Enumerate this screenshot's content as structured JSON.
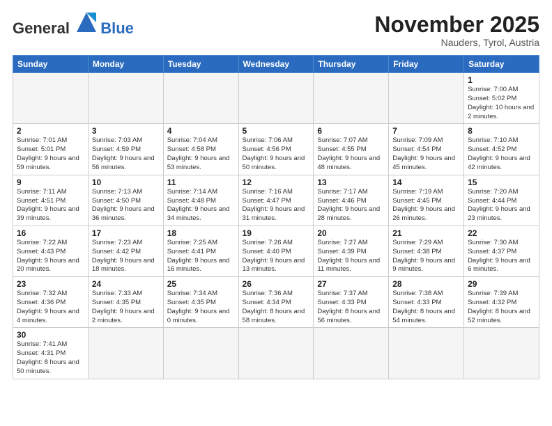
{
  "logo": {
    "text_general": "General",
    "text_blue": "Blue"
  },
  "header": {
    "month": "November 2025",
    "location": "Nauders, Tyrol, Austria"
  },
  "weekdays": [
    "Sunday",
    "Monday",
    "Tuesday",
    "Wednesday",
    "Thursday",
    "Friday",
    "Saturday"
  ],
  "days": {
    "1": {
      "sunrise": "7:00 AM",
      "sunset": "5:02 PM",
      "daylight": "10 hours and 2 minutes."
    },
    "2": {
      "sunrise": "7:01 AM",
      "sunset": "5:01 PM",
      "daylight": "9 hours and 59 minutes."
    },
    "3": {
      "sunrise": "7:03 AM",
      "sunset": "4:59 PM",
      "daylight": "9 hours and 56 minutes."
    },
    "4": {
      "sunrise": "7:04 AM",
      "sunset": "4:58 PM",
      "daylight": "9 hours and 53 minutes."
    },
    "5": {
      "sunrise": "7:06 AM",
      "sunset": "4:56 PM",
      "daylight": "9 hours and 50 minutes."
    },
    "6": {
      "sunrise": "7:07 AM",
      "sunset": "4:55 PM",
      "daylight": "9 hours and 48 minutes."
    },
    "7": {
      "sunrise": "7:09 AM",
      "sunset": "4:54 PM",
      "daylight": "9 hours and 45 minutes."
    },
    "8": {
      "sunrise": "7:10 AM",
      "sunset": "4:52 PM",
      "daylight": "9 hours and 42 minutes."
    },
    "9": {
      "sunrise": "7:11 AM",
      "sunset": "4:51 PM",
      "daylight": "9 hours and 39 minutes."
    },
    "10": {
      "sunrise": "7:13 AM",
      "sunset": "4:50 PM",
      "daylight": "9 hours and 36 minutes."
    },
    "11": {
      "sunrise": "7:14 AM",
      "sunset": "4:48 PM",
      "daylight": "9 hours and 34 minutes."
    },
    "12": {
      "sunrise": "7:16 AM",
      "sunset": "4:47 PM",
      "daylight": "9 hours and 31 minutes."
    },
    "13": {
      "sunrise": "7:17 AM",
      "sunset": "4:46 PM",
      "daylight": "9 hours and 28 minutes."
    },
    "14": {
      "sunrise": "7:19 AM",
      "sunset": "4:45 PM",
      "daylight": "9 hours and 26 minutes."
    },
    "15": {
      "sunrise": "7:20 AM",
      "sunset": "4:44 PM",
      "daylight": "9 hours and 23 minutes."
    },
    "16": {
      "sunrise": "7:22 AM",
      "sunset": "4:43 PM",
      "daylight": "9 hours and 20 minutes."
    },
    "17": {
      "sunrise": "7:23 AM",
      "sunset": "4:42 PM",
      "daylight": "9 hours and 18 minutes."
    },
    "18": {
      "sunrise": "7:25 AM",
      "sunset": "4:41 PM",
      "daylight": "9 hours and 16 minutes."
    },
    "19": {
      "sunrise": "7:26 AM",
      "sunset": "4:40 PM",
      "daylight": "9 hours and 13 minutes."
    },
    "20": {
      "sunrise": "7:27 AM",
      "sunset": "4:39 PM",
      "daylight": "9 hours and 11 minutes."
    },
    "21": {
      "sunrise": "7:29 AM",
      "sunset": "4:38 PM",
      "daylight": "9 hours and 9 minutes."
    },
    "22": {
      "sunrise": "7:30 AM",
      "sunset": "4:37 PM",
      "daylight": "9 hours and 6 minutes."
    },
    "23": {
      "sunrise": "7:32 AM",
      "sunset": "4:36 PM",
      "daylight": "9 hours and 4 minutes."
    },
    "24": {
      "sunrise": "7:33 AM",
      "sunset": "4:35 PM",
      "daylight": "9 hours and 2 minutes."
    },
    "25": {
      "sunrise": "7:34 AM",
      "sunset": "4:35 PM",
      "daylight": "9 hours and 0 minutes."
    },
    "26": {
      "sunrise": "7:36 AM",
      "sunset": "4:34 PM",
      "daylight": "8 hours and 58 minutes."
    },
    "27": {
      "sunrise": "7:37 AM",
      "sunset": "4:33 PM",
      "daylight": "8 hours and 56 minutes."
    },
    "28": {
      "sunrise": "7:38 AM",
      "sunset": "4:33 PM",
      "daylight": "8 hours and 54 minutes."
    },
    "29": {
      "sunrise": "7:39 AM",
      "sunset": "4:32 PM",
      "daylight": "8 hours and 52 minutes."
    },
    "30": {
      "sunrise": "7:41 AM",
      "sunset": "4:31 PM",
      "daylight": "8 hours and 50 minutes."
    }
  }
}
